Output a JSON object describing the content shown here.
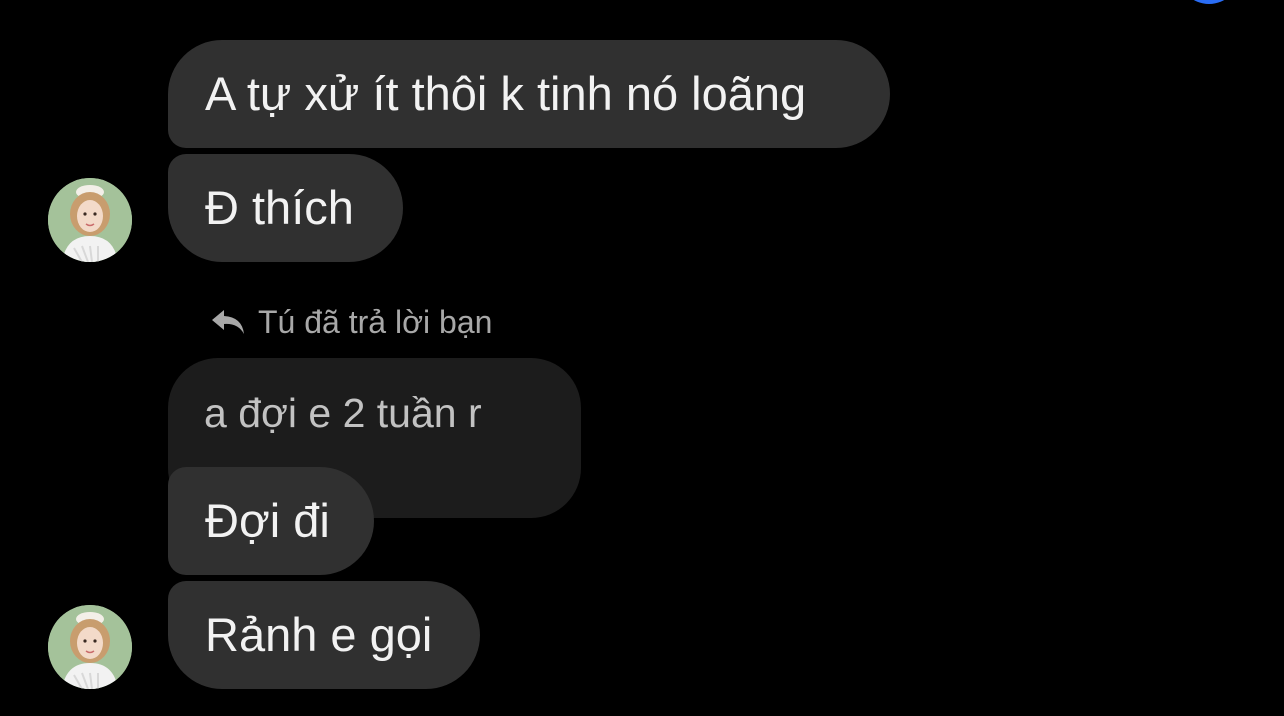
{
  "messages": [
    {
      "text": "A tự xử ít thôi k tinh nó loãng"
    },
    {
      "text": "Đ thích"
    },
    {
      "text": "Đợi đi"
    },
    {
      "text": "Rảnh e gọi"
    }
  ],
  "reply_context": {
    "label": "Tú đã trả lời bạn",
    "quoted_text": "a đợi e 2 tuần r"
  },
  "icons": {
    "reply": "reply-arrow-icon",
    "avatar": "contact-avatar"
  },
  "colors": {
    "background": "#000000",
    "bubble": "#303030",
    "quoted_bubble": "#1c1c1c",
    "accent": "#2a6df5"
  }
}
